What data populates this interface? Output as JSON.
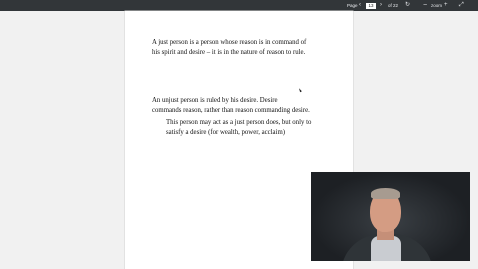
{
  "toolbar": {
    "page_label": "Page",
    "current_page": "13",
    "of_label": "of 22",
    "zoom_label": "zoom",
    "icons": {
      "prev": "chevron-left-icon",
      "next": "chevron-right-icon",
      "rotate": "rotate-icon",
      "zoom_out": "minus-icon",
      "zoom_in": "plus-icon",
      "expand": "expand-icon"
    },
    "background_color": "#323639"
  },
  "document": {
    "paragraph1": [
      "A just person is a person whose reason is in command of",
      "his spirit and desire – it is in the nature of reason to rule."
    ],
    "paragraph2": [
      "An unjust person is ruled by his desire.   Desire",
      "commands reason, rather than reason commanding desire."
    ],
    "paragraph3": [
      "This person may act as a just person does, but only to",
      "satisfy a desire (for wealth, power, acclaim)"
    ]
  },
  "video": {
    "content": "presenter-webcam"
  }
}
